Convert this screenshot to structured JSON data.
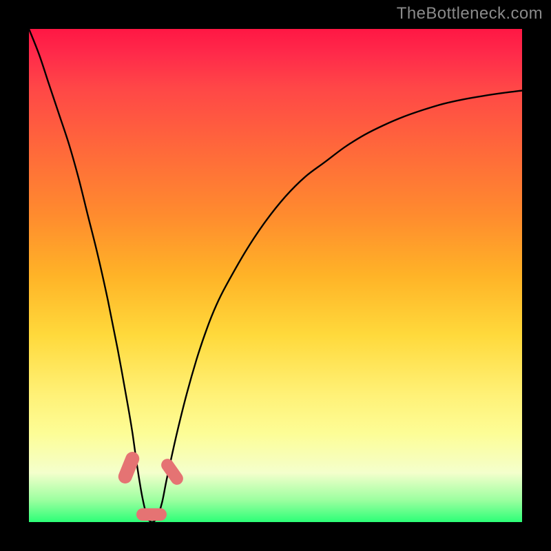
{
  "watermark": "TheBottleneck.com",
  "colors": {
    "background": "#000000",
    "gradient_top": "#ff1744",
    "gradient_mid1": "#ff8c2e",
    "gradient_mid2": "#ffd93b",
    "gradient_mid3": "#fdfd96",
    "gradient_bottom": "#2cff77",
    "curve": "#000000",
    "marker": "#e57373",
    "watermark_text": "#8a8a8a"
  },
  "chart_data": {
    "type": "line",
    "title": "",
    "xlabel": "",
    "ylabel": "",
    "xlim": [
      0,
      100
    ],
    "ylim": [
      0,
      100
    ],
    "grid": false,
    "legend": false,
    "series": [
      {
        "name": "bottleneck-curve",
        "x": [
          0,
          2,
          4,
          6,
          8,
          10,
          12,
          14,
          16,
          18,
          20,
          21,
          22,
          23,
          24,
          25,
          26,
          27,
          28,
          30,
          32,
          34,
          36,
          38,
          40,
          44,
          48,
          52,
          56,
          60,
          64,
          68,
          72,
          76,
          80,
          84,
          88,
          92,
          96,
          100
        ],
        "y": [
          100,
          95,
          89,
          83,
          77,
          70,
          62,
          54,
          45,
          35,
          24,
          18,
          11,
          5,
          1,
          0,
          1,
          4,
          9,
          18,
          26,
          33,
          39,
          44,
          48,
          55,
          61,
          66,
          70,
          73,
          76,
          78.5,
          80.5,
          82.2,
          83.6,
          84.8,
          85.7,
          86.4,
          87,
          87.5
        ]
      }
    ],
    "markers": [
      {
        "shape": "pill",
        "x": 21.5,
        "y": 13,
        "w": 3.5,
        "h": 9,
        "angle": 68
      },
      {
        "shape": "pill",
        "x": 25,
        "y": 0.5,
        "w": 6,
        "h": 3,
        "angle": 0
      },
      {
        "shape": "pill",
        "x": 29,
        "y": 12,
        "w": 3,
        "h": 8,
        "angle": -55
      }
    ],
    "notes": "y-axis inverted visually (0 at bottom = green = no bottleneck, 100 at top = red = severe bottleneck). Curve dips to 0 near x≈25 then rises asymptotically toward ~88."
  }
}
